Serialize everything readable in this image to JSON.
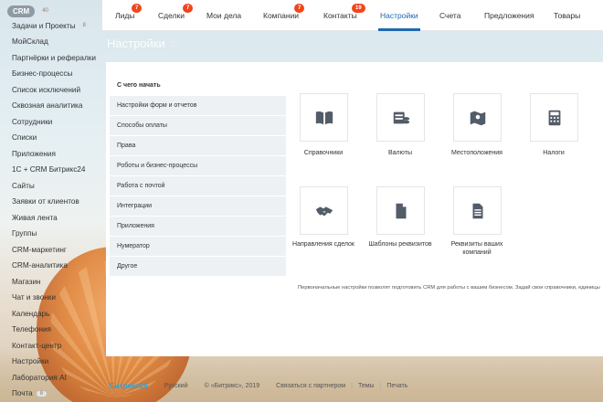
{
  "left_menu": {
    "crm_label": "CRM",
    "crm_count": "40",
    "items": [
      {
        "label": "Задачи и Проекты",
        "count": "8"
      },
      {
        "label": "МойСклад"
      },
      {
        "label": "Партнёрки и рефералки"
      },
      {
        "label": "Бизнес-процессы"
      },
      {
        "label": "Список исключений"
      },
      {
        "label": "Сквозная аналитика"
      },
      {
        "label": "Сотрудники"
      },
      {
        "label": "Списки"
      },
      {
        "label": "Приложения"
      },
      {
        "label": "1С + CRM Битрикс24"
      },
      {
        "label": "Сайты"
      },
      {
        "label": "Заявки от клиентов"
      },
      {
        "label": "Живая лента"
      },
      {
        "label": "Группы"
      },
      {
        "label": "CRM-маркетинг"
      },
      {
        "label": "CRM-аналитика"
      },
      {
        "label": "Магазин"
      },
      {
        "label": "Чат и звонки"
      },
      {
        "label": "Календарь"
      },
      {
        "label": "Телефония"
      },
      {
        "label": "Контакт-центр"
      },
      {
        "label": "Настройки"
      },
      {
        "label": "Лаборатория AI"
      },
      {
        "label": "Почта",
        "count": "8"
      }
    ]
  },
  "topbar": {
    "tabs": [
      {
        "label": "Лиды",
        "badge": "7"
      },
      {
        "label": "Сделки",
        "badge": "7"
      },
      {
        "label": "Мои дела"
      },
      {
        "label": "Компании",
        "badge": "7"
      },
      {
        "label": "Контакты",
        "badge": "19"
      },
      {
        "label": "Настройки",
        "active": true
      },
      {
        "label": "Счета"
      },
      {
        "label": "Предложения"
      },
      {
        "label": "Товары"
      }
    ]
  },
  "page": {
    "title": "Настройки",
    "star": "☆"
  },
  "settings": {
    "section_title": "С чего начать",
    "items": [
      "Настройки форм и отчетов",
      "Способы оплаты",
      "Права",
      "Роботы и бизнес-процессы",
      "Работа с почтой",
      "Интеграции",
      "Приложения",
      "Нумератор",
      "Другое"
    ],
    "tiles": [
      {
        "label": "Справочники",
        "icon": "book-icon"
      },
      {
        "label": "Валюты",
        "icon": "coins-icon"
      },
      {
        "label": "Местоположения",
        "icon": "map-icon"
      },
      {
        "label": "Налоги",
        "icon": "calculator-icon"
      },
      {
        "label": "Направления сделок",
        "icon": "handshake-icon"
      },
      {
        "label": "Шаблоны реквизитов",
        "icon": "document-icon"
      },
      {
        "label": "Реквизиты ваших компаний",
        "icon": "document-lines-icon"
      }
    ],
    "hint": "Первоначальные настройки позволят подготовить CRM для работы с вашим бизнесом. Задай свои справочники, единицы"
  },
  "footer": {
    "logo": "Битрикс24",
    "language": "Русский",
    "copyright": "© «Битрикс», 2019",
    "partner": "Связаться с партнером",
    "themes": "Темы",
    "print": "Печать"
  },
  "colors": {
    "accent": "#2067b0",
    "badge": "#f0461c",
    "submenu_bg": "#eef1f3"
  }
}
